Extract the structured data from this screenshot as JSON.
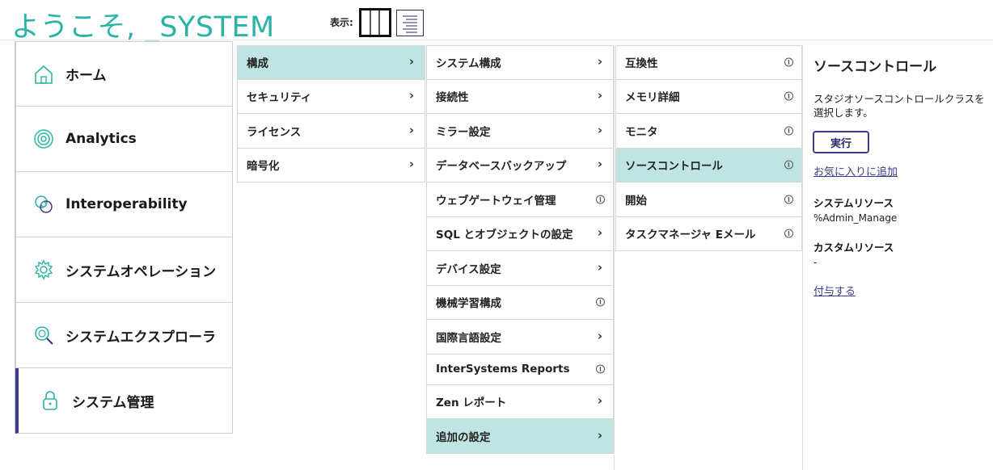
{
  "header": {
    "welcome": "ようこそ, _SYSTEM",
    "view_label": "表示:"
  },
  "main_menu": [
    {
      "label": "ホーム",
      "icon": "home-icon"
    },
    {
      "label": "Analytics",
      "icon": "analytics-icon"
    },
    {
      "label": "Interoperability",
      "icon": "interoperability-icon"
    },
    {
      "label": "システムオペレーション",
      "icon": "gear-icon"
    },
    {
      "label": "システムエクスプローラ",
      "icon": "search-icon"
    },
    {
      "label": "システム管理",
      "icon": "lock-icon",
      "active": true
    }
  ],
  "column2": [
    {
      "label": "構成",
      "selected": true
    },
    {
      "label": "セキュリティ"
    },
    {
      "label": "ライセンス"
    },
    {
      "label": "暗号化"
    }
  ],
  "column3": [
    {
      "label": "システム構成"
    },
    {
      "label": "接続性"
    },
    {
      "label": "ミラー設定"
    },
    {
      "label": "データベースバックアップ"
    },
    {
      "label": "ウェブゲートウェイ管理"
    },
    {
      "label": "SQL とオブジェクトの設定"
    },
    {
      "label": "デバイス設定"
    },
    {
      "label": "機械学習構成"
    },
    {
      "label": "国際言語設定"
    },
    {
      "label": "InterSystems Reports"
    },
    {
      "label": "Zen レポート"
    },
    {
      "label": "追加の設定",
      "selected": true
    }
  ],
  "column4": [
    {
      "label": "互換性"
    },
    {
      "label": "メモリ詳細"
    },
    {
      "label": "モニタ"
    },
    {
      "label": "ソースコントロール",
      "selected": true
    },
    {
      "label": "開始"
    },
    {
      "label": "タスクマネージャ Eメール"
    }
  ],
  "detail": {
    "title": "ソースコントロール",
    "description": "スタジオソースコントロールクラスを選択します。",
    "run_button": "実行",
    "favorite_link": "お気に入りに追加",
    "system_resource_label": "システムリソース",
    "system_resource_value": "%Admin_Manage",
    "custom_resource_label": "カスタムリソース",
    "custom_resource_value": "-",
    "grant_link": "付与する"
  },
  "colors": {
    "accent": "#2bb3a8",
    "selected_bg": "#bfe4e2",
    "active_bar": "#3b3b8c"
  }
}
